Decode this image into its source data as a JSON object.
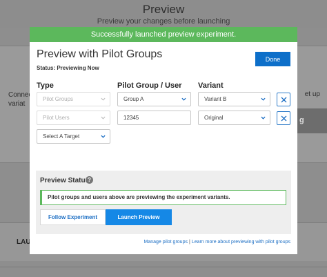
{
  "background": {
    "title": "Preview",
    "subtitle": "Preview your changes before launching",
    "side_left_1": "Connec",
    "side_left_2": "variat",
    "side_right": "et up",
    "side_button": "g",
    "lower_label": "LAU"
  },
  "banner": {
    "text": "Successfully launched preview experiment."
  },
  "modal": {
    "title": "Preview with Pilot Groups",
    "status": "Status: Previewing Now",
    "done_label": "Done",
    "columns": {
      "type": "Type",
      "group": "Pilot Group / User",
      "variant": "Variant"
    },
    "rows": [
      {
        "type": "Pilot Groups",
        "group": "Group A",
        "variant": "Variant B"
      },
      {
        "type": "Pilot Users",
        "group": "12345",
        "variant": "Original"
      }
    ],
    "target_select": "Select A Target",
    "preview_status": {
      "title": "Preview Status",
      "help": "?",
      "message": "Pilot groups and users above are previewing the experiment variants.",
      "follow_label": "Follow Experiment",
      "launch_label": "Launch Preview"
    },
    "links": {
      "manage": "Manage pilot groups",
      "sep": "|",
      "learn": "Learn more about previewing with pilot groups"
    }
  },
  "colors": {
    "primary": "#0d6fc9",
    "success": "#5cb85c",
    "link": "#1d6fc4"
  }
}
